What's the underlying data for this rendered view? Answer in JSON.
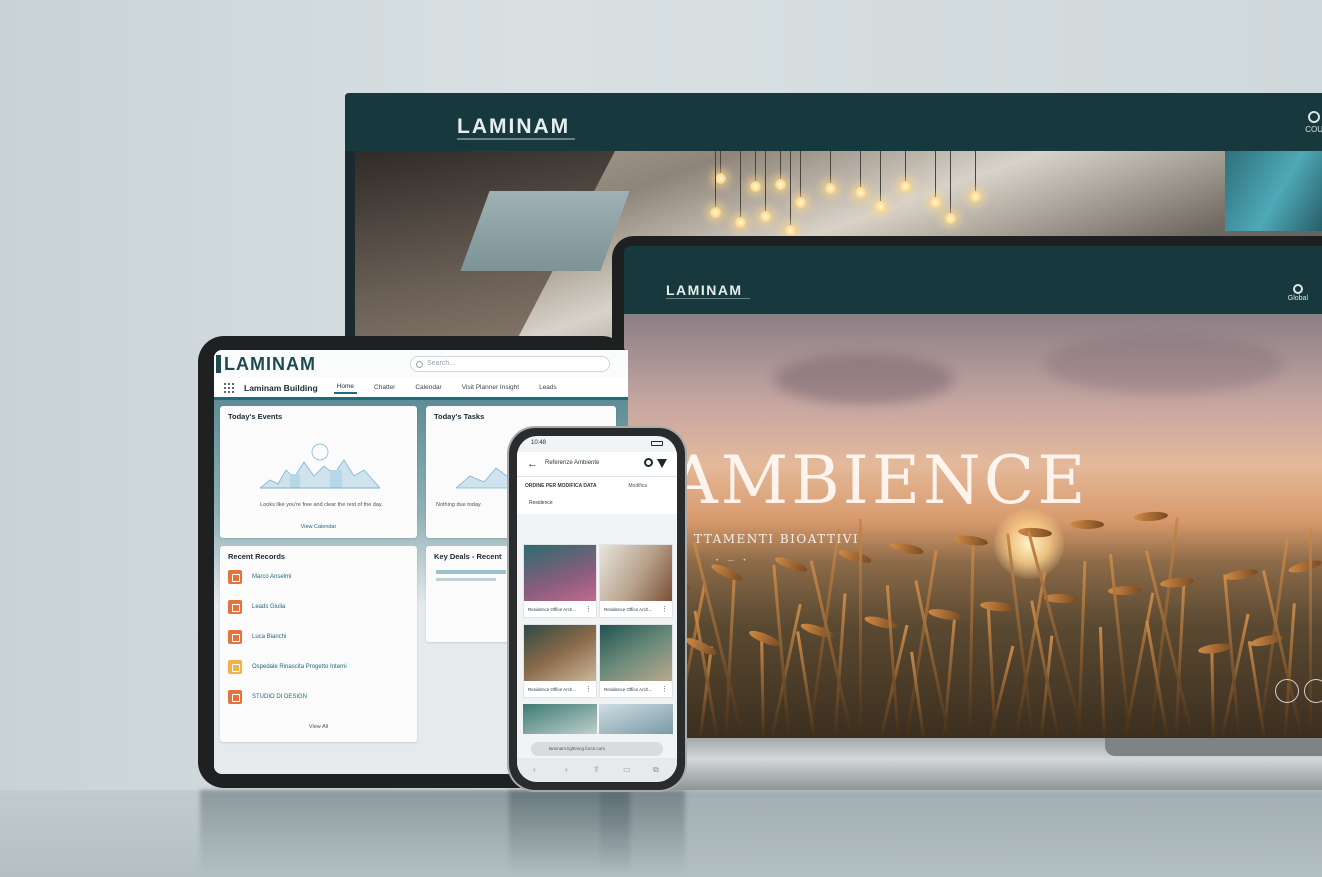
{
  "monitor": {
    "logo": "LAMINAM",
    "corner_label": "COU"
  },
  "laptop": {
    "logo": "LAMINAM",
    "corner_label": "Global",
    "hero_title": "AMBIENCE",
    "hero_subtitle": "TTAMENTI BIOATTIVI"
  },
  "tablet": {
    "logo": "LAMINAM",
    "search_placeholder": "Search...",
    "app_name": "Laminam Building",
    "tabs": [
      "Home",
      "Chatter",
      "Calendar",
      "Visit Planner Insight",
      "Leads"
    ],
    "events_title": "Today's Events",
    "events_message": "Looks like you're free and clear the rest of the day.",
    "events_link": "View Calendar",
    "tasks_title": "Today's Tasks",
    "tasks_message": "Nothing due today.",
    "deals_title": "Key Deals - Recent",
    "recent_title": "Recent Records",
    "recent_items": [
      "Marco Anselmi",
      "Leads Giulia",
      "Luca Bianchi",
      "Ospedale Rinascita Progetto Interni",
      "STUDIO DI DESIGN"
    ],
    "view_all": "View All"
  },
  "phone": {
    "time": "10:48",
    "title": "Referenze Ambiente",
    "count_label": "ORDINE PER MODIFICA DATA",
    "sort_label": "Modifica",
    "chip": "Residence",
    "tiles": [
      "Residence Office Arch...",
      "Residence Office Arch...",
      "Residence Office Arch...",
      "Residence Office Arch..."
    ],
    "url": "laminam.lightning.force.com"
  }
}
